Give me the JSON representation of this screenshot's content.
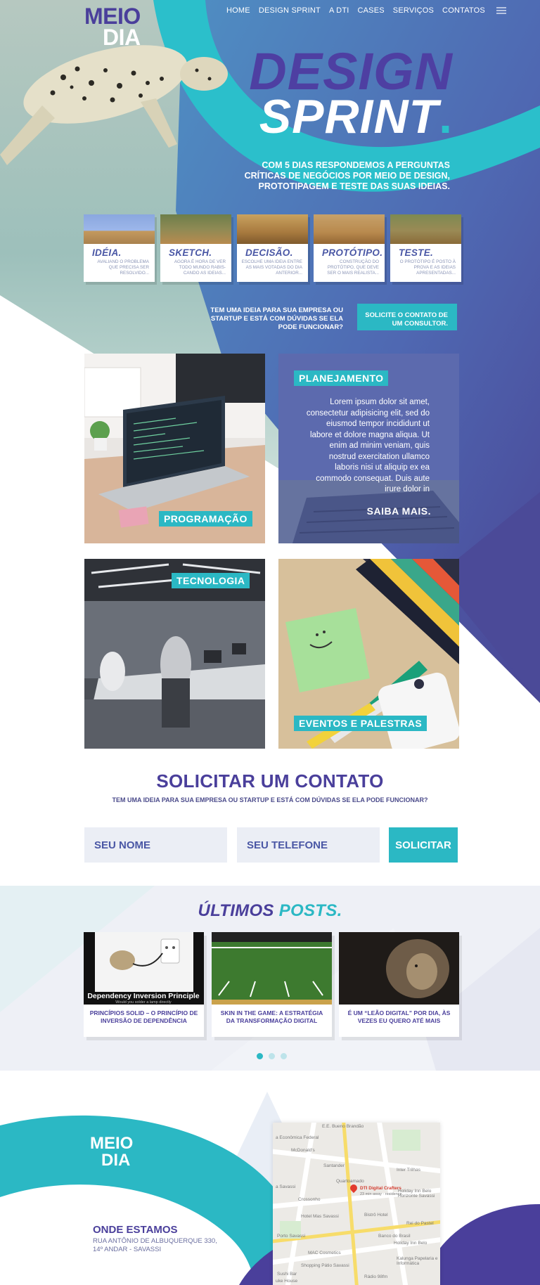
{
  "brand": {
    "line1": "MEIO",
    "line2": "DIA"
  },
  "nav": {
    "items": [
      "HOME",
      "DESIGN SPRINT",
      "A DTI",
      "CASES",
      "SERVIÇOS",
      "CONTATOS"
    ],
    "menu_icon": "hamburger-icon"
  },
  "hero": {
    "title_line1": "DESIGN",
    "title_line2": "SPRINT",
    "title_dot": ".",
    "desc_pre": "COM ",
    "desc_bold": "5 DIAS",
    "desc_post": " RESPONDEMOS A PERGUNTAS CRÍTICAS DE NEGÓCIOS POR MEIO DE DESIGN, PROTOTIPAGEM E TESTE DAS SUAS IDEIAS."
  },
  "steps": [
    {
      "title": "IDÉIA.",
      "desc": "AVALIAND O PROBLEMA QUE PRECISA SER RESOLVIDO..."
    },
    {
      "title": "SKETCH.",
      "desc": "AGORA É HORA DE VER TODO MUNDO RABIS-CANDO AS IDEIAS..."
    },
    {
      "title": "DECISÃO.",
      "desc": "ESCOLHE UMA IDEIA ENTRE AS MAIS VOTADAS DO DIA ANTERIOR..."
    },
    {
      "title": "PROTÓTIPO.",
      "desc": "CONSTRUÇÃO DO PROTÓTIPO, QUE DEVE SER O MAIS REALISTA..."
    },
    {
      "title": "TESTE.",
      "desc": "O PROTÓTIPO É POSTO À PROVA E AS IDEIAS APRESENTADAS..."
    }
  ],
  "cta": {
    "text": "TEM UMA IDEIA PARA SUA EMPRESA OU STARTUP E ESTÁ COM DÚVIDAS SE ELA PODE FUNCIONAR?",
    "button": "SOLICITE O CONTATO DE UM CONSULTOR."
  },
  "cards": {
    "programacao": "PROGRAMAÇÃO",
    "planejamento": "PLANEJAMENTO",
    "plan_text": "Lorem ipsum dolor sit amet, consectetur adipisicing elit, sed do eiusmod tempor incididunt ut labore et dolore magna aliqua. Ut enim ad minim veniam, quis nostrud exercitation ullamco laboris nisi ut aliquip ex ea commodo consequat. Duis aute irure dolor in",
    "saiba": "SAIBA MAIS.",
    "tecnologia": "TECNOLOGIA",
    "eventos": "EVENTOS E PALESTRAS"
  },
  "contact": {
    "title": "SOLICITAR UM CONTATO",
    "subtitle": "TEM UMA IDEIA PARA SUA EMPRESA OU STARTUP E ESTÁ COM DÚVIDAS SE ELA PODE FUNCIONAR?",
    "name_placeholder": "SEU NOME",
    "phone_placeholder": "SEU TELEFONE",
    "submit": "SOLICITAR"
  },
  "posts": {
    "title_a": "ÚLTIMOS",
    "title_b": "POSTS.",
    "items": [
      {
        "title": "PRINCÍPIOS SOLID – O PRINCÍPIO DE INVERSÃO DE DEPENDÊNCIA",
        "caption": "Dependency Inversion Principle",
        "caption_sub": "Would you solder a lamp directly"
      },
      {
        "title": "SKIN IN THE GAME: A ESTRATÉGIA DA TRANSFORMAÇÃO DIGITAL"
      },
      {
        "title": "É UM “LEÃO DIGITAL” POR DIA, ÀS VEZES EU QUERO ATÉ MAIS"
      }
    ],
    "dots": 3,
    "active_dot": 0
  },
  "footer": {
    "logo_line1": "MEIO",
    "logo_line2": "DIA",
    "onde": "ONDE ESTAMOS",
    "addr1": "RUA ANTÔNIO DE ALBUQUERQUE 330,",
    "addr2": "14º ANDAR - SAVASSI"
  },
  "map": {
    "labels": [
      "E.E. Bueno Brandão",
      "a Econômica Federal",
      "McDonald's",
      "Santander",
      "Inter Trilhas",
      "a Savassi",
      "Quartoamado",
      "DTI Digital Crafters",
      "23 min away · residence",
      "Holiday Inn Belo Horizonte Savassi",
      "Crossonho",
      "Hotel Mas Savassi",
      "Bistrô Hotel",
      "Rei do Pastel",
      "Porto Savassi",
      "Banco do Brasil",
      "MAC Cosmetics",
      "Holiday Inn Belo",
      "Kalunga Papelaria e Informática",
      "Shopping Pátio Savassi",
      "Sushi Bar",
      "Rádio 98fm",
      "uke House"
    ]
  },
  "colors": {
    "purple": "#4a3f9b",
    "teal": "#2bb8c4",
    "blue": "#4a57a5"
  }
}
